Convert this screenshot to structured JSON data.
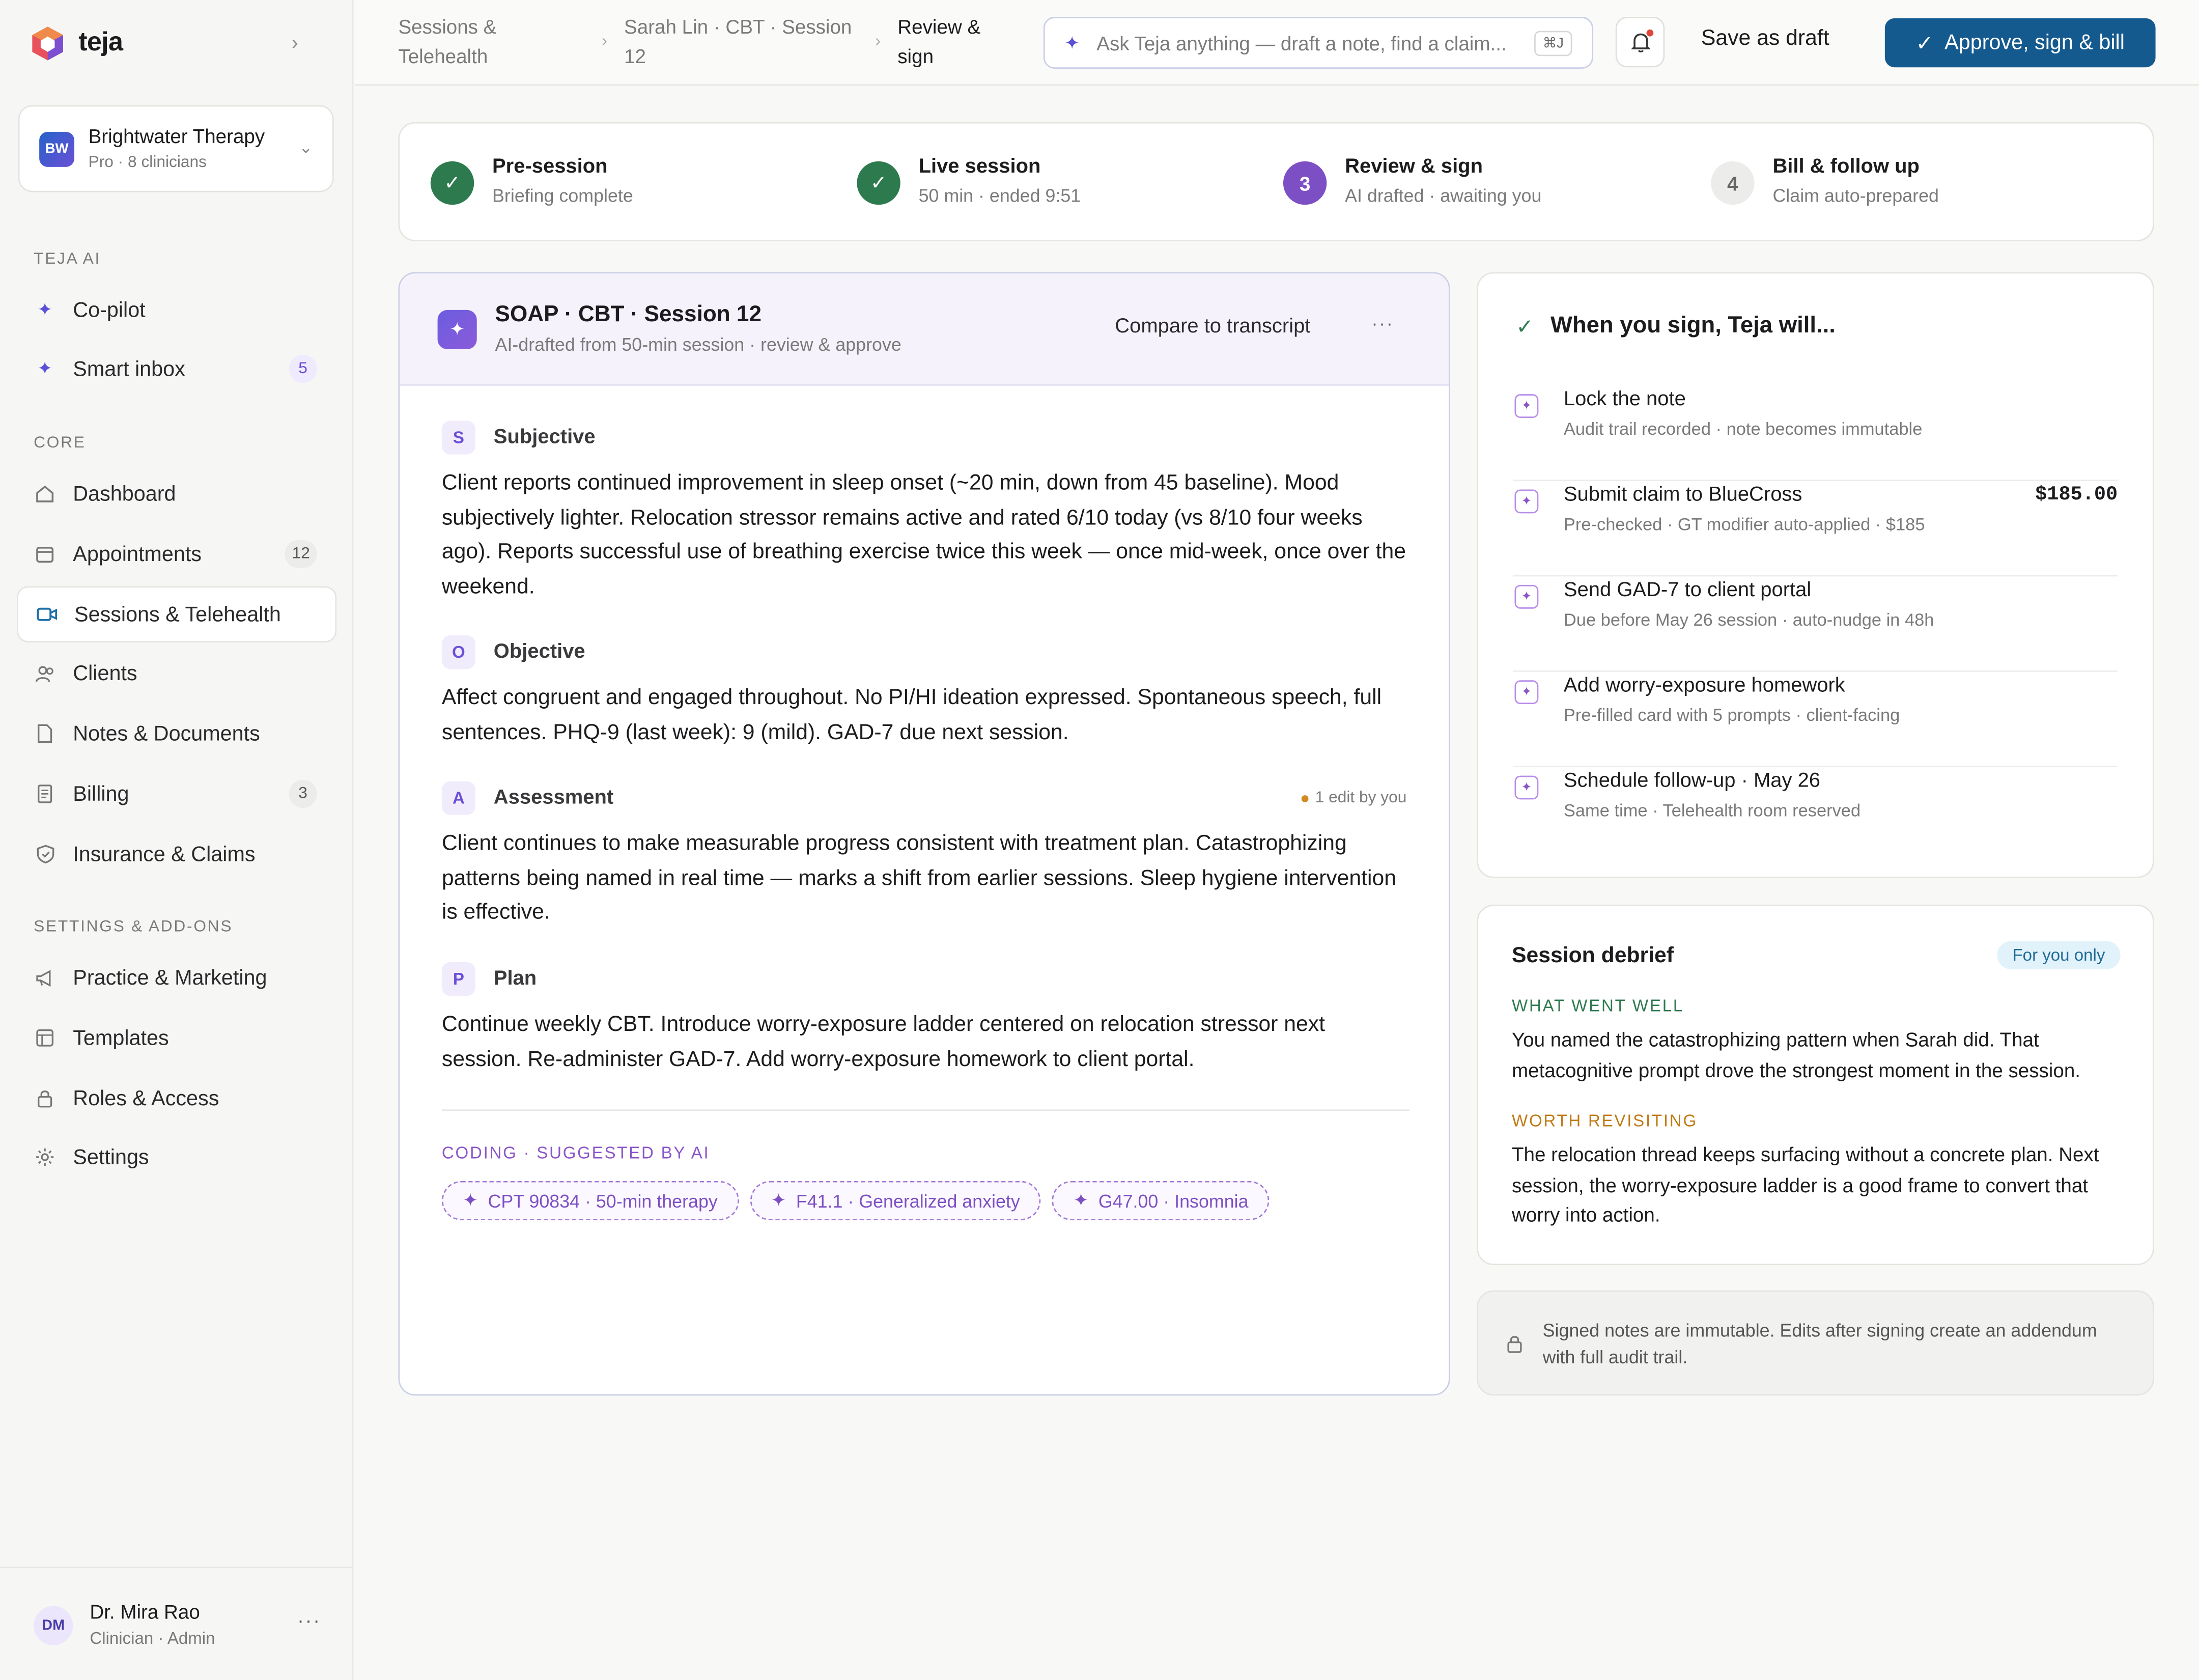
{
  "app": {
    "name": "teja"
  },
  "org": {
    "initials": "BW",
    "name": "Brightwater Therapy",
    "plan": "Pro · 8 clinicians"
  },
  "sidebar": {
    "sections": {
      "ai": "TEJA AI",
      "core": "CORE",
      "settings": "SETTINGS & ADD-ONS"
    },
    "items": [
      {
        "label": "Co-pilot",
        "icon": "sparkle-icon"
      },
      {
        "label": "Smart inbox",
        "icon": "sparkle-icon",
        "badge": "5"
      },
      {
        "label": "Dashboard",
        "icon": "home-icon"
      },
      {
        "label": "Appointments",
        "icon": "calendar-icon",
        "badge": "12"
      },
      {
        "label": "Sessions & Telehealth",
        "icon": "video-icon",
        "active": true
      },
      {
        "label": "Clients",
        "icon": "users-icon"
      },
      {
        "label": "Notes & Documents",
        "icon": "document-icon"
      },
      {
        "label": "Billing",
        "icon": "receipt-icon",
        "badge": "3"
      },
      {
        "label": "Insurance & Claims",
        "icon": "shield-icon"
      },
      {
        "label": "Practice & Marketing",
        "icon": "megaphone-icon"
      },
      {
        "label": "Templates",
        "icon": "template-icon"
      },
      {
        "label": "Roles & Access",
        "icon": "lock-icon"
      },
      {
        "label": "Settings",
        "icon": "gear-icon"
      }
    ]
  },
  "user": {
    "initials": "DM",
    "name": "Dr. Mira Rao",
    "role": "Clinician · Admin"
  },
  "breadcrumb": {
    "items": [
      "Sessions & Telehealth",
      "Sarah Lin · CBT · Session 12",
      "Review & sign"
    ]
  },
  "search": {
    "placeholder": "Ask Teja anything — draft a note, find a claim...",
    "shortcut": "⌘J"
  },
  "toolbar": {
    "draft_label": "Save as draft",
    "approve_label": "Approve, sign & bill"
  },
  "steps": [
    {
      "marker": "✓",
      "state": "done",
      "title": "Pre-session",
      "sub": "Briefing complete"
    },
    {
      "marker": "✓",
      "state": "done",
      "title": "Live session",
      "sub": "50 min · ended 9:51"
    },
    {
      "marker": "3",
      "state": "current",
      "title": "Review & sign",
      "sub": "AI drafted · awaiting you"
    },
    {
      "marker": "4",
      "state": "todo",
      "title": "Bill & follow up",
      "sub": "Claim auto-prepared"
    }
  ],
  "soap": {
    "title": "SOAP · CBT · Session 12",
    "subtitle": "AI-drafted from 50-min session · review & approve",
    "compare_label": "Compare to transcript",
    "sections": [
      {
        "letter": "S",
        "title": "Subjective",
        "body": "Client reports continued improvement in sleep onset (~20 min, down from 45 baseline). Mood subjectively lighter. Relocation stressor remains active and rated 6/10 today (vs 8/10 four weeks ago). Reports successful use of breathing exercise twice this week — once mid-week, once over the weekend."
      },
      {
        "letter": "O",
        "title": "Objective",
        "body": "Affect congruent and engaged throughout. No PI/HI ideation expressed. Spontaneous speech, full sentences. PHQ-9 (last week): 9 (mild). GAD-7 due next session."
      },
      {
        "letter": "A",
        "title": "Assessment",
        "note": "1 edit by you",
        "body": "Client continues to make measurable progress consistent with treatment plan. Catastrophizing patterns being named in real time — marks a shift from earlier sessions. Sleep hygiene intervention is effective."
      },
      {
        "letter": "P",
        "title": "Plan",
        "body": "Continue weekly CBT. Introduce worry-exposure ladder centered on relocation stressor next session. Re-administer GAD-7. Add worry-exposure homework to client portal."
      }
    ],
    "coding_label": "CODING · SUGGESTED BY AI",
    "codes": [
      "CPT 90834 · 50-min therapy",
      "F41.1 · Generalized anxiety",
      "G47.00 · Insomnia"
    ]
  },
  "sign_panel": {
    "title": "When you sign, Teja will...",
    "actions": [
      {
        "title": "Lock the note",
        "sub": "Audit trail recorded · note becomes immutable"
      },
      {
        "title": "Submit claim to BlueCross",
        "sub": "Pre-checked · GT modifier auto-applied · $185",
        "amount": "$185.00"
      },
      {
        "title": "Send GAD-7 to client portal",
        "sub": "Due before May 26 session · auto-nudge in 48h"
      },
      {
        "title": "Add worry-exposure homework",
        "sub": "Pre-filled card with 5 prompts · client-facing"
      },
      {
        "title": "Schedule follow-up · May 26",
        "sub": "Same time · Telehealth room reserved"
      }
    ]
  },
  "debrief": {
    "title": "Session debrief",
    "badge": "For you only",
    "went_well_label": "WHAT WENT WELL",
    "went_well": "You named the catastrophizing pattern when Sarah did. That metacognitive prompt drove the strongest moment in the session.",
    "revisit_label": "WORTH REVISITING",
    "revisit": "The relocation thread keeps surfacing without a concrete plan. Next session, the worry-exposure ladder is a good frame to convert that worry into action."
  },
  "immutable_note": "Signed notes are immutable. Edits after signing create an addendum with full audit trail.",
  "colors": {
    "primary": "#155a8f",
    "ai_purple": "#7d4fc4",
    "success": "#2e7a4f",
    "warning": "#d28b1e"
  }
}
